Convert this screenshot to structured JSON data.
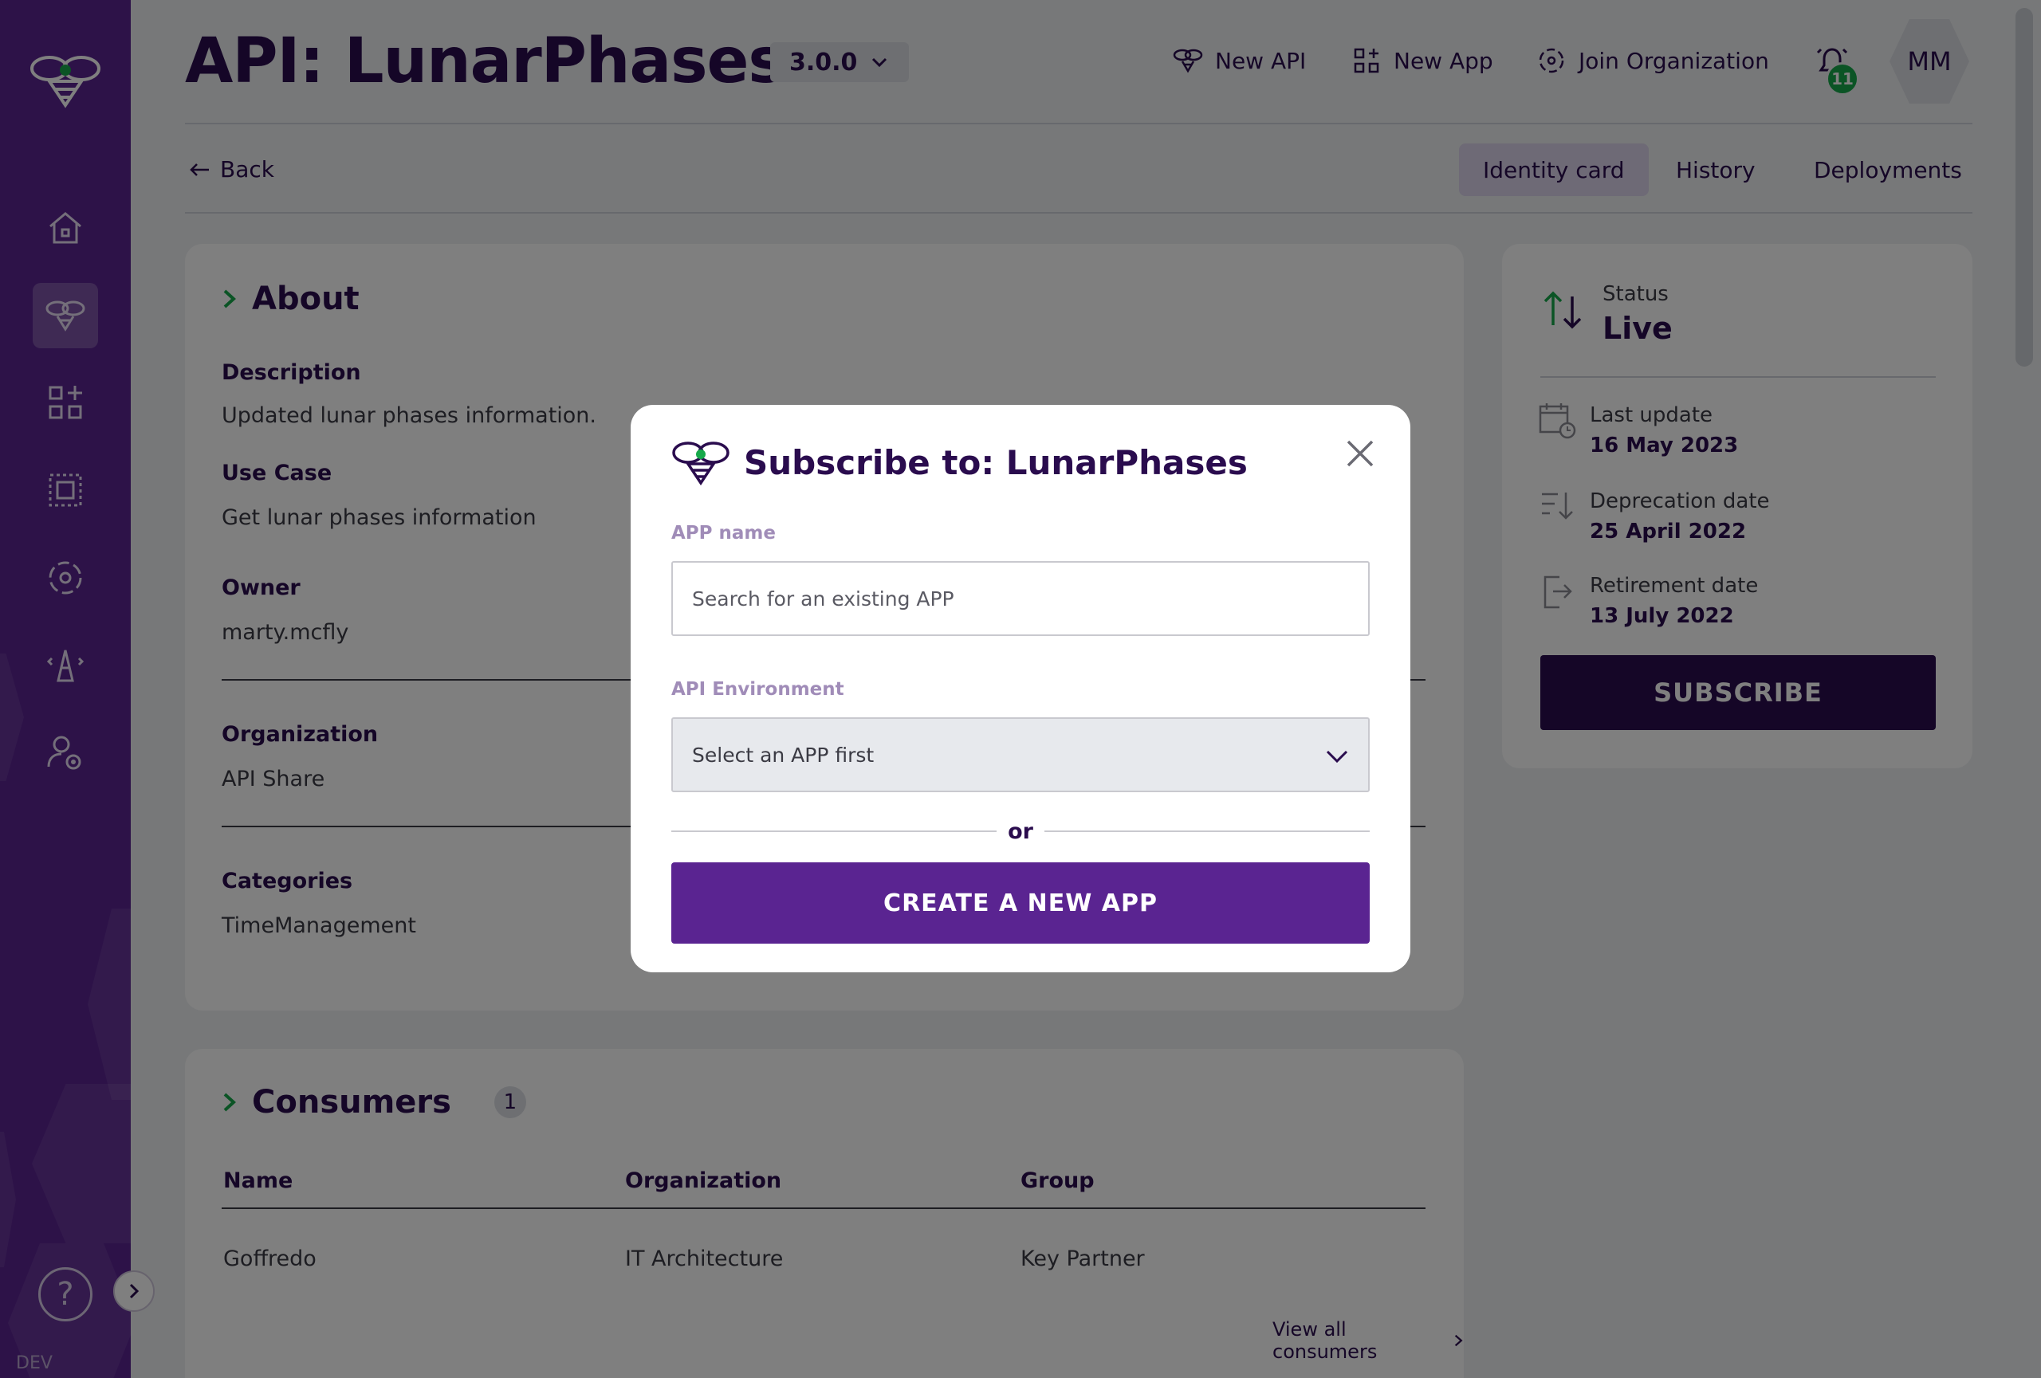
{
  "sidebar": {
    "nav": [
      {
        "icon": "home-icon"
      },
      {
        "icon": "api-bee-icon"
      },
      {
        "icon": "apps-add-icon"
      },
      {
        "icon": "dashboard-icon"
      },
      {
        "icon": "organization-icon"
      },
      {
        "icon": "deployment-tower-icon"
      },
      {
        "icon": "user-settings-icon"
      }
    ],
    "help_label": "?",
    "env_label": "DEV"
  },
  "header": {
    "title": "API: LunarPhases",
    "version": "3.0.0",
    "actions": [
      {
        "label": "New API",
        "icon": "bee-icon"
      },
      {
        "label": "New App",
        "icon": "grid-add-icon"
      },
      {
        "label": "Join Organization",
        "icon": "organization-icon"
      }
    ],
    "notifications_count": "11",
    "avatar_initials": "MM"
  },
  "subnav": {
    "back_label": "Back",
    "tabs": [
      {
        "label": "Identity card",
        "active": true
      },
      {
        "label": "History",
        "active": false
      },
      {
        "label": "Deployments",
        "active": false
      }
    ]
  },
  "about": {
    "title": "About",
    "description_label": "Description",
    "description": "Updated lunar phases information.",
    "use_case_label": "Use Case",
    "use_case": "Get lunar phases information",
    "owner_label": "Owner",
    "owner": "marty.mcfly",
    "organization_label": "Organization",
    "organization": "API Share",
    "categories_label": "Categories",
    "categories": "TimeManagement"
  },
  "status": {
    "status_label": "Status",
    "status_value": "Live",
    "last_update_label": "Last update",
    "last_update": "16 May 2023",
    "deprecation_label": "Deprecation date",
    "deprecation": "25 April 2022",
    "retirement_label": "Retirement date",
    "retirement": "13 July 2022",
    "subscribe_label": "SUBSCRIBE"
  },
  "consumers": {
    "title": "Consumers",
    "count": "1",
    "columns": [
      "Name",
      "Organization",
      "Group"
    ],
    "rows": [
      [
        "Goffredo",
        "IT Architecture",
        "Key Partner"
      ]
    ],
    "view_all_label": "View all consumers"
  },
  "modal": {
    "title": "Subscribe to: LunarPhases",
    "app_name_label": "APP name",
    "app_name_placeholder": "Search for an existing APP",
    "app_name_value": "",
    "env_label": "API Environment",
    "env_selected": "Select an APP first",
    "or_label": "or",
    "create_label": "CREATE A NEW APP"
  },
  "colors": {
    "brand_purple": "#5a2491",
    "dark_purple": "#2a0c4e",
    "accent_green": "#17a94a"
  }
}
